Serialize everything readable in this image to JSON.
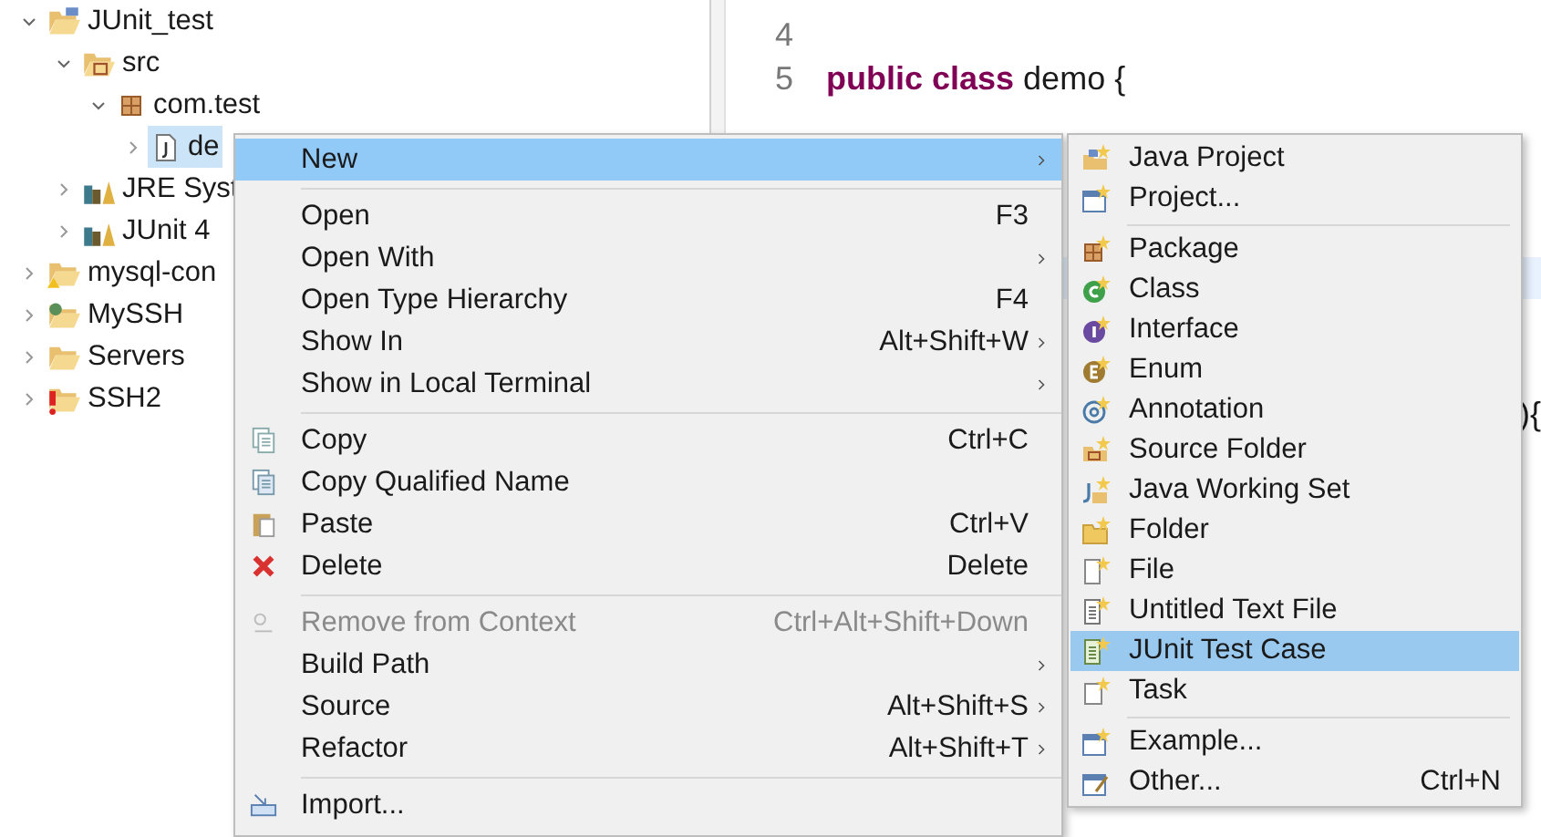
{
  "tree": [
    {
      "label": "JUnit_test",
      "expanded": true,
      "selected": false,
      "children": [
        {
          "label": "src",
          "expanded": true,
          "selected": false,
          "children": [
            {
              "label": "com.test",
              "expanded": true,
              "selected": false,
              "children": [
                {
                  "label": "de",
                  "expanded": false,
                  "selected": true
                }
              ]
            }
          ]
        },
        {
          "label": "JRE Syst",
          "expanded": false,
          "selected": false
        },
        {
          "label": "JUnit 4",
          "expanded": false,
          "selected": false
        }
      ]
    },
    {
      "label": "mysql-con",
      "expanded": false,
      "selected": false
    },
    {
      "label": "MySSH",
      "expanded": false,
      "selected": false
    },
    {
      "label": "Servers",
      "expanded": false,
      "selected": false
    },
    {
      "label": "SSH2",
      "expanded": false,
      "selected": false
    }
  ],
  "editor": {
    "lines": [
      {
        "number": "4"
      },
      {
        "number": "5",
        "code": "**public class** demo {"
      }
    ],
    "fragment": "){"
  },
  "context_menu": {
    "items": [
      {
        "kind": "item",
        "label": "New",
        "submenu": true,
        "selected": true,
        "disabled": false
      },
      {
        "kind": "separator"
      },
      {
        "kind": "item",
        "label": "Open",
        "shortcut": "F3",
        "submenu": false,
        "selected": false,
        "disabled": false
      },
      {
        "kind": "item",
        "label": "Open With",
        "submenu": true,
        "selected": false,
        "disabled": false
      },
      {
        "kind": "item",
        "label": "Open Type Hierarchy",
        "shortcut": "F4",
        "submenu": false,
        "selected": false,
        "disabled": false
      },
      {
        "kind": "item",
        "label": "Show In",
        "shortcut": "Alt+Shift+W",
        "submenu": true,
        "selected": false,
        "disabled": false
      },
      {
        "kind": "item",
        "label": "Show in Local Terminal",
        "submenu": true,
        "selected": false,
        "disabled": false
      },
      {
        "kind": "separator"
      },
      {
        "kind": "item",
        "label": "Copy",
        "shortcut": "Ctrl+C",
        "submenu": false,
        "selected": false,
        "disabled": false
      },
      {
        "kind": "item",
        "label": "Copy Qualified Name",
        "submenu": false,
        "selected": false,
        "disabled": false
      },
      {
        "kind": "item",
        "label": "Paste",
        "shortcut": "Ctrl+V",
        "submenu": false,
        "selected": false,
        "disabled": false
      },
      {
        "kind": "item",
        "label": "Delete",
        "shortcut": "Delete",
        "submenu": false,
        "selected": false,
        "disabled": false
      },
      {
        "kind": "separator"
      },
      {
        "kind": "item",
        "label": "Remove from Context",
        "shortcut": "Ctrl+Alt+Shift+Down",
        "submenu": false,
        "selected": false,
        "disabled": true
      },
      {
        "kind": "item",
        "label": "Build Path",
        "submenu": true,
        "selected": false,
        "disabled": false
      },
      {
        "kind": "item",
        "label": "Source",
        "shortcut": "Alt+Shift+S",
        "submenu": true,
        "selected": false,
        "disabled": false
      },
      {
        "kind": "item",
        "label": "Refactor",
        "shortcut": "Alt+Shift+T",
        "submenu": true,
        "selected": false,
        "disabled": false
      },
      {
        "kind": "separator"
      },
      {
        "kind": "item",
        "label": "Import...",
        "submenu": false,
        "selected": false,
        "disabled": false
      }
    ]
  },
  "new_submenu": {
    "items": [
      {
        "kind": "item",
        "label": "Java Project",
        "selected": false
      },
      {
        "kind": "item",
        "label": "Project...",
        "selected": false
      },
      {
        "kind": "separator"
      },
      {
        "kind": "item",
        "label": "Package",
        "selected": false
      },
      {
        "kind": "item",
        "label": "Class",
        "selected": false
      },
      {
        "kind": "item",
        "label": "Interface",
        "selected": false
      },
      {
        "kind": "item",
        "label": "Enum",
        "selected": false
      },
      {
        "kind": "item",
        "label": "Annotation",
        "selected": false
      },
      {
        "kind": "item",
        "label": "Source Folder",
        "selected": false
      },
      {
        "kind": "item",
        "label": "Java Working Set",
        "selected": false
      },
      {
        "kind": "item",
        "label": "Folder",
        "selected": false
      },
      {
        "kind": "item",
        "label": "File",
        "selected": false
      },
      {
        "kind": "item",
        "label": "Untitled Text File",
        "selected": false
      },
      {
        "kind": "item",
        "label": "JUnit Test Case",
        "selected": true
      },
      {
        "kind": "item",
        "label": "Task",
        "selected": false
      },
      {
        "kind": "separator"
      },
      {
        "kind": "item",
        "label": "Example...",
        "selected": false
      },
      {
        "kind": "item",
        "label": "Other...",
        "shortcut": "Ctrl+N",
        "selected": false
      }
    ]
  }
}
